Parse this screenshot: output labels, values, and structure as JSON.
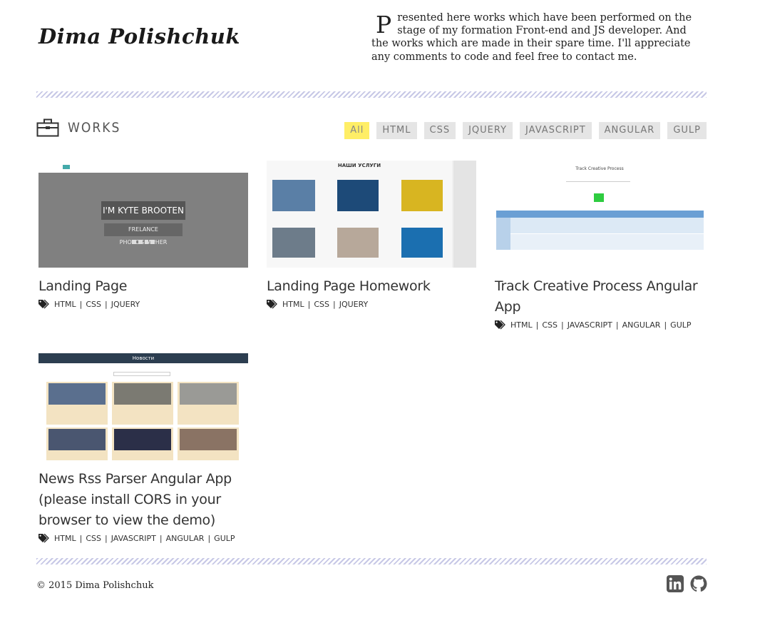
{
  "header": {
    "brand": "Dima Polishchuk",
    "intro_drop": "P",
    "intro_rest": "resented here works which have been performed on the stage of my formation Front-end and JS developer. And the works which are made in their spare time. I'll appreciate any comments to code and feel free to contact me."
  },
  "works": {
    "title": "WORKS",
    "filters": [
      "All",
      "HTML",
      "CSS",
      "JQUERY",
      "JAVASCRIPT",
      "ANGULAR",
      "GULP"
    ],
    "active_filter": "All",
    "items": [
      {
        "title": "Landing Page",
        "tags": [
          "HTML",
          "CSS",
          "JQUERY"
        ],
        "thumb": {
          "headline": "I'M KYTE BROOTEN",
          "subline": "FRELANCE PHOTOGRAPHER"
        }
      },
      {
        "title": "Landing Page Homework",
        "tags": [
          "HTML",
          "CSS",
          "JQUERY"
        ],
        "thumb": {
          "headline": "НАШИ УСЛУГИ"
        }
      },
      {
        "title": "Track Creative Process Angular App",
        "tags": [
          "HTML",
          "CSS",
          "JAVASCRIPT",
          "ANGULAR",
          "GULP"
        ],
        "thumb": {
          "headline": "Track Creative Process"
        }
      },
      {
        "title": "News Rss Parser Angular App (please install CORS in your browser to view the demo)",
        "tags": [
          "HTML",
          "CSS",
          "JAVASCRIPT",
          "ANGULAR",
          "GULP"
        ],
        "thumb": {
          "headline": "Новости"
        }
      }
    ]
  },
  "footer": {
    "copyright": "© 2015 Dima Polishchuk",
    "social": [
      "linkedin-icon",
      "github-icon"
    ]
  },
  "colors": {
    "active_filter": "#ffee66",
    "filter_bg": "#e5e5e5",
    "hatch": "#c7c8e6"
  }
}
